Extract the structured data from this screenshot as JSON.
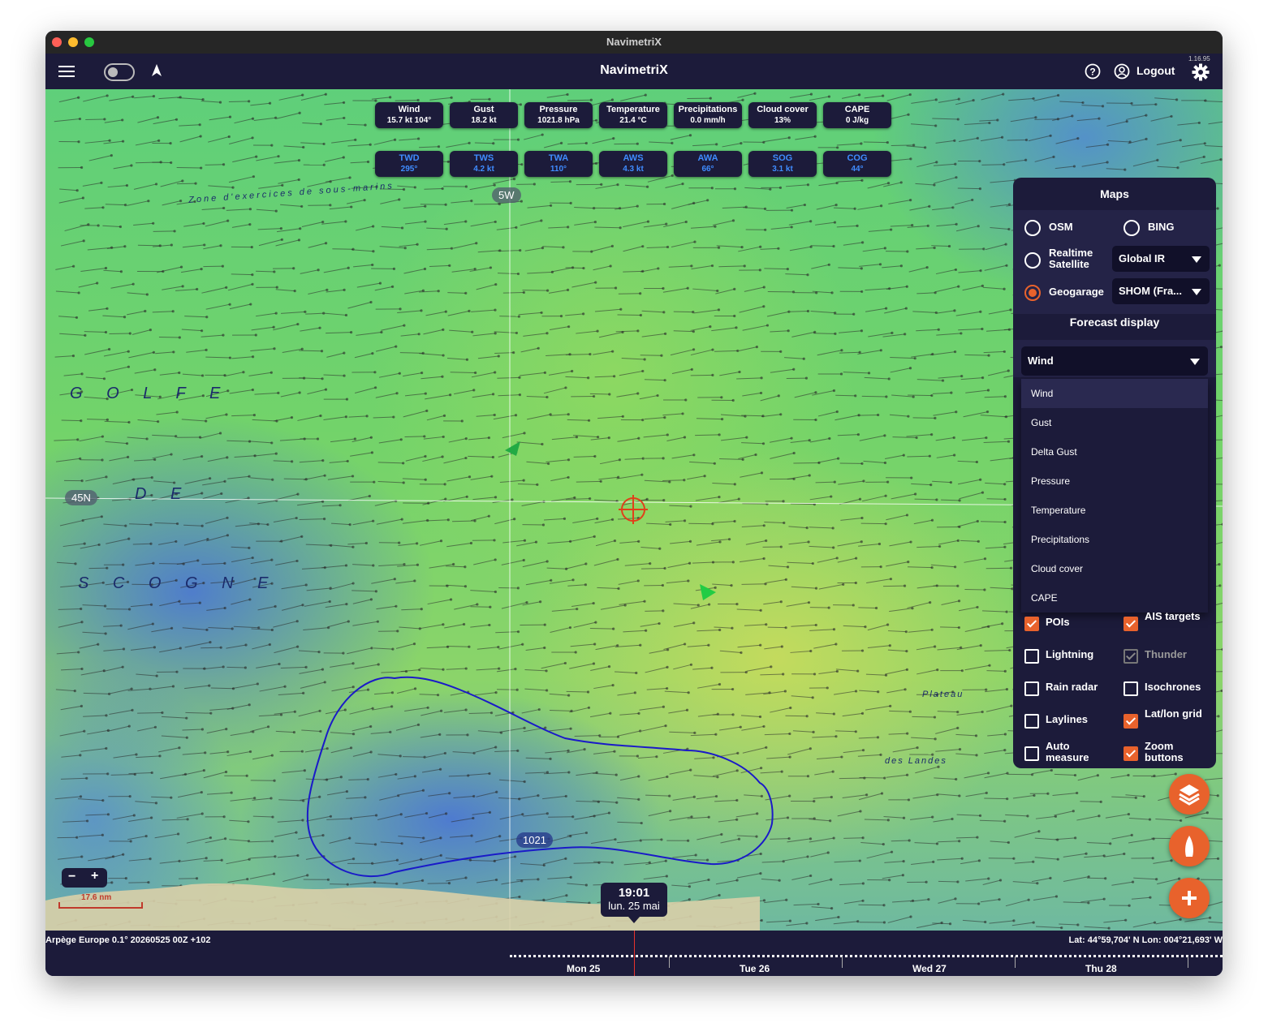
{
  "window": {
    "title": "NavimetriX"
  },
  "appbar": {
    "title": "NavimetriX",
    "version": "1.16.95",
    "logout_label": "Logout"
  },
  "instruments_top": [
    {
      "label": "Wind",
      "value": "15.7 kt 104°"
    },
    {
      "label": "Gust",
      "value": "18.2 kt"
    },
    {
      "label": "Pressure",
      "value": "1021.8 hPa"
    },
    {
      "label": "Temperature",
      "value": "21.4 °C"
    },
    {
      "label": "Precipitations",
      "value": "0.0 mm/h"
    },
    {
      "label": "Cloud cover",
      "value": "13%"
    },
    {
      "label": "CAPE",
      "value": "0 J/kg"
    }
  ],
  "instruments_bottom": [
    {
      "label": "TWD",
      "value": "295°"
    },
    {
      "label": "TWS",
      "value": "4.2 kt"
    },
    {
      "label": "TWA",
      "value": "110°"
    },
    {
      "label": "AWS",
      "value": "4.3 kt"
    },
    {
      "label": "AWA",
      "value": "66°"
    },
    {
      "label": "SOG",
      "value": "3.1 kt"
    },
    {
      "label": "COG",
      "value": "44°"
    }
  ],
  "map": {
    "grid_lon_label": "5W",
    "grid_lat_label": "45N",
    "isobar_label": "1021",
    "scale_label": "17.6 nm",
    "time": "19:01",
    "date": "lun. 25 mai",
    "chart_text": [
      "G O L F E",
      "D E",
      "S C O G N E",
      "Zone d'exercices de sous-marins",
      "Plateau",
      "des Landes"
    ]
  },
  "panel": {
    "maps_title": "Maps",
    "osm": "OSM",
    "bing": "BING",
    "realtime_satellite": "Realtime Satellite",
    "satellite_select": "Global IR",
    "geogarage": "Geogarage",
    "geogarage_select": "SHOM (Fra...",
    "forecast_title": "Forecast display",
    "forecast_selected": "Wind",
    "forecast_options": [
      "Wind",
      "Gust",
      "Delta Gust",
      "Pressure",
      "Temperature",
      "Precipitations",
      "Cloud cover",
      "CAPE"
    ],
    "checks": [
      {
        "label": "POIs",
        "checked": true
      },
      {
        "label": "AIS targets",
        "checked": true
      },
      {
        "label": "Lightning",
        "checked": false
      },
      {
        "label": "Thunder",
        "checked": true,
        "disabled": true
      },
      {
        "label": "Rain radar",
        "checked": false
      },
      {
        "label": "Isochrones",
        "checked": false
      },
      {
        "label": "Laylines",
        "checked": false
      },
      {
        "label": "Lat/lon grid",
        "checked": true
      },
      {
        "label": "Auto measure",
        "checked": false
      },
      {
        "label": "Zoom buttons",
        "checked": true
      }
    ]
  },
  "zoom": {
    "minus": "−",
    "plus": "+"
  },
  "bottom": {
    "model": "Arpège Europe 0.1° 20260525 00Z +102",
    "position": "Lat: 44°59,704' N Lon: 004°21,693' W",
    "days": [
      "Mon 25",
      "Tue 26",
      "Wed 27",
      "Thu 28"
    ]
  },
  "colors": {
    "accent": "#e8622c",
    "panel": "#1c1b3a",
    "instrument_blue": "#3f8cff"
  }
}
